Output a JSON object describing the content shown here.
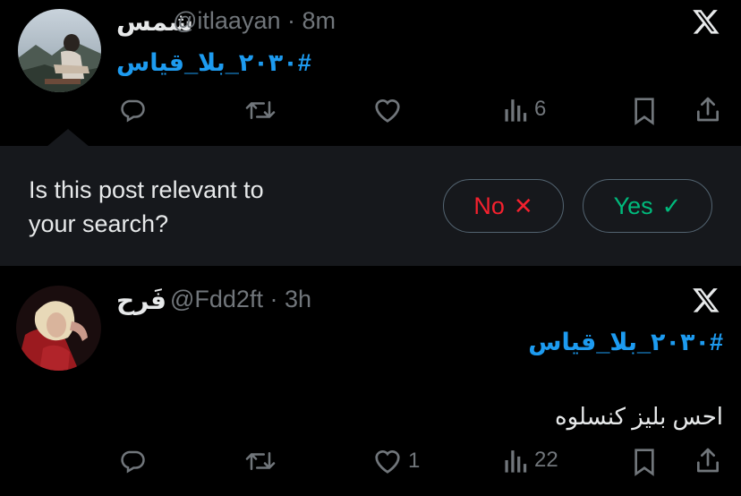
{
  "tweets": [
    {
      "display_name": "شمس",
      "handle": "@itlaayan",
      "separator": "·",
      "time": "8m",
      "hashtag": "#٢٠٣٠_بلا_قياس",
      "body": "",
      "reply_count": "",
      "retweet_count": "",
      "like_count": "",
      "view_count": "6"
    },
    {
      "display_name": "فَرح",
      "handle": "@Fdd2ft",
      "separator": "·",
      "time": "3h",
      "hashtag": "#٢٠٣٠_بلا_قياس",
      "body": "احس بليز كنسلوه",
      "reply_count": "",
      "retweet_count": "",
      "like_count": "1",
      "view_count": "22"
    }
  ],
  "feedback": {
    "question_line1": "Is this post relevant to",
    "question_line2": "your search?",
    "no_label": "No",
    "no_icon": "✕",
    "yes_label": "Yes",
    "yes_icon": "✓"
  },
  "colors": {
    "accent": "#1d9bf0",
    "no": "#f4212e",
    "yes": "#00ba7c",
    "muted": "#71767b",
    "panel": "#16181c"
  },
  "icons": [
    "x-logo-icon",
    "reply-icon",
    "retweet-icon",
    "like-icon",
    "views-icon",
    "bookmark-icon",
    "share-icon"
  ]
}
